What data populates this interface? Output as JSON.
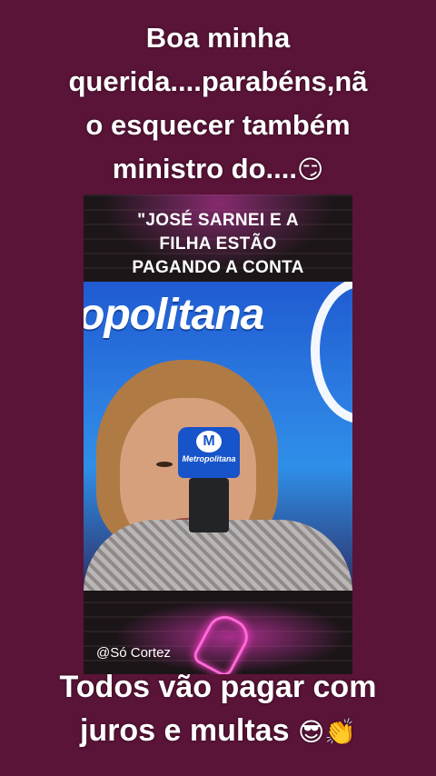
{
  "post": {
    "top_caption": [
      "Boa minha",
      "querida....parabéns,nã",
      "o esquecer também",
      "ministro do...."
    ],
    "top_caption_emoji": "😏",
    "bottom_caption": [
      "Todos vão pagar com",
      "juros e multas"
    ],
    "bottom_caption_emoji": "😎👏"
  },
  "video": {
    "quote": [
      "\"JOSÉ SARNEI E A",
      "FILHA ESTÃO",
      "PAGANDO A CONTA"
    ],
    "backdrop_logo_text": "opolitana",
    "mic_badge": "M",
    "mic_label": "Metropolitana",
    "watermark": "@Só Cortez"
  },
  "colors": {
    "background": "#5a1438",
    "caption_text": "#ffffff",
    "studio_blue": "#2b7ae0",
    "neon_pink": "#ff40c8"
  }
}
